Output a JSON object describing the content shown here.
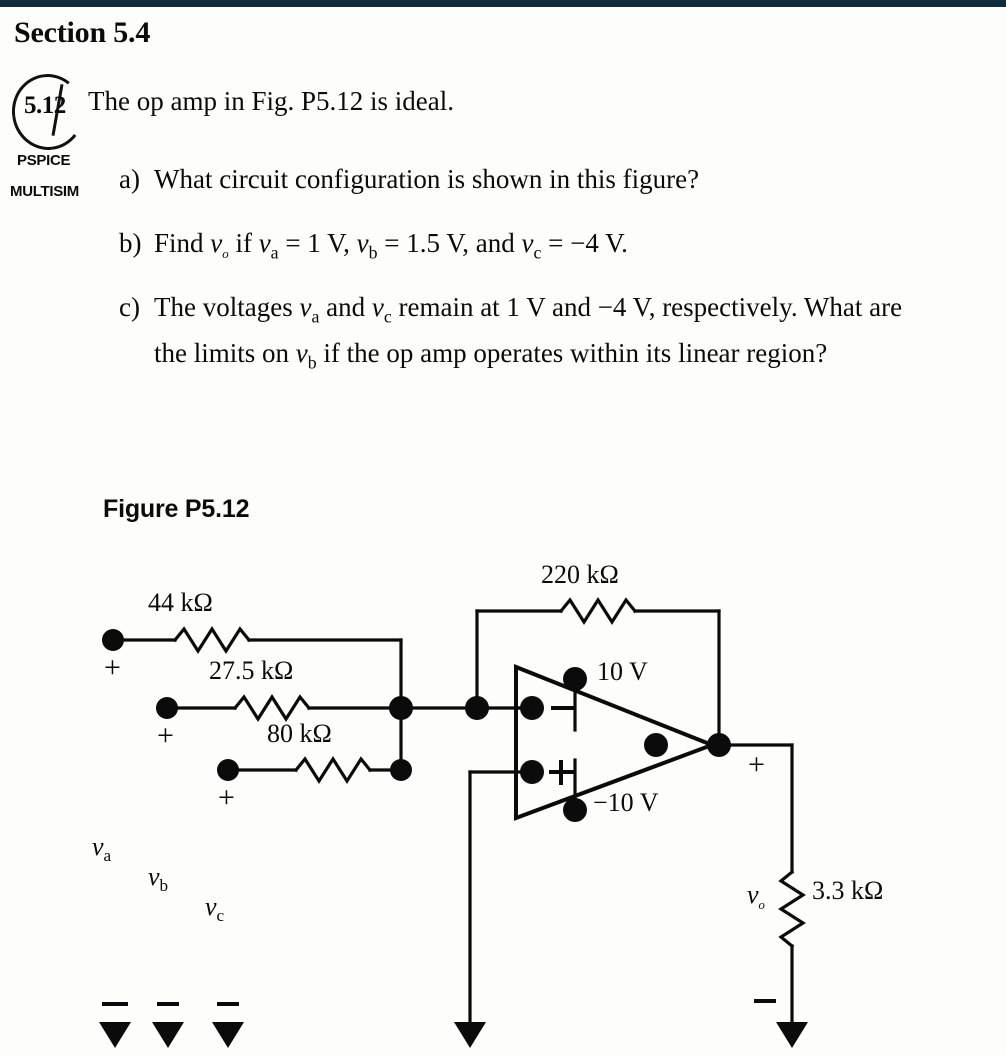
{
  "document": {
    "section_heading": "Section 5.4",
    "problem_number": "5.12",
    "badges": [
      "PSPICE",
      "MULTISIM"
    ],
    "stem": "The op amp in Fig. P5.12 is ideal.",
    "parts": [
      {
        "marker": "a)",
        "text": "What circuit configuration is shown in this figure?"
      },
      {
        "marker": "b)",
        "text_pre": "Find ",
        "sym1": "v",
        "sym1_sub": "o",
        "text_mid1": " if ",
        "sym2": "v",
        "sym2_sub": "a",
        "text_mid2": " = 1 V, ",
        "sym3": "v",
        "sym3_sub": "b",
        "text_mid3": " = 1.5 V, and ",
        "sym4": "v",
        "sym4_sub": "c",
        "text_end": " = −4 V."
      },
      {
        "marker": "c)",
        "text_pre": "The voltages ",
        "sym1": "v",
        "sym1_sub": "a",
        "text_mid1": " and ",
        "sym2": "v",
        "sym2_sub": "c",
        "text_mid2": " remain at 1 V and −4 V, respectively. What are the limits on ",
        "sym3": "v",
        "sym3_sub": "b",
        "text_end": " if the op amp operates within its linear region?"
      }
    ],
    "figure_caption": "Figure P5.12"
  },
  "figure": {
    "resistors": [
      {
        "id": "r-44k",
        "label": "44 kΩ"
      },
      {
        "id": "r-275k",
        "label": "27.5 kΩ"
      },
      {
        "id": "r-80k",
        "label": "80 kΩ"
      },
      {
        "id": "r-220k",
        "label": "220 kΩ"
      },
      {
        "id": "r-33k",
        "label": "3.3 kΩ"
      }
    ],
    "supplies": [
      {
        "id": "vcc-pos",
        "label": "10 V"
      },
      {
        "id": "vcc-neg",
        "label": "−10 V"
      }
    ],
    "opamp": {
      "inverting_label": "−",
      "noninverting_label": "+"
    },
    "sources": [
      {
        "id": "src-a",
        "symbol": "v",
        "sub": "a",
        "polarity_top": "+",
        "polarity_bottom": "−"
      },
      {
        "id": "src-b",
        "symbol": "v",
        "sub": "b",
        "polarity_top": "+",
        "polarity_bottom": "−"
      },
      {
        "id": "src-c",
        "symbol": "v",
        "sub": "c",
        "polarity_top": "+",
        "polarity_bottom": "−"
      }
    ],
    "output": {
      "symbol": "v",
      "sub": "o",
      "polarity_top": "+",
      "polarity_bottom": "−",
      "load_label": "3.3 kΩ"
    },
    "colors": {
      "wire": "#0b0b0b",
      "paper": "#fdfdfb",
      "topbar": "#122b3c"
    }
  }
}
